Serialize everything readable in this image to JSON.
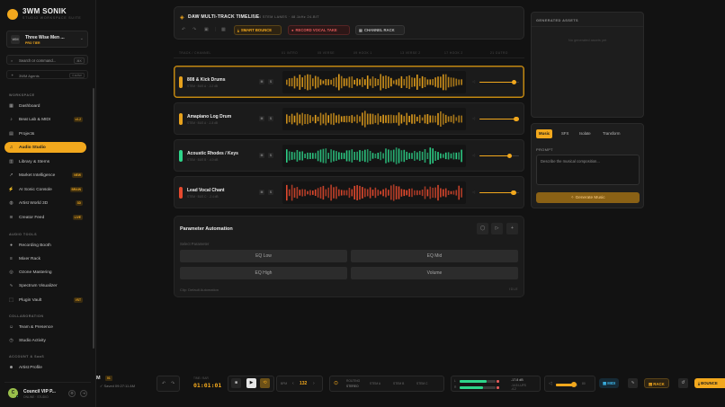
{
  "brand": {
    "title": "3WM SONIK",
    "subtitle": "STUDIO WORKSPACE SUITE"
  },
  "user": {
    "initials": "WM",
    "name": "Three Wise Men ...",
    "tier": "PRO TIER"
  },
  "search": {
    "placeholder": "Search or command...",
    "shortcut": "⌘K"
  },
  "agents": {
    "label": "3WM Agents",
    "tag": "4 active"
  },
  "sidebar": {
    "sections": [
      {
        "label": "WORKSPACE",
        "items": [
          {
            "label": "Dashboard",
            "icon": "▦",
            "badge": ""
          },
          {
            "label": "Beat Lab & MIDI",
            "icon": "♪",
            "badge": "v1.2"
          },
          {
            "label": "Projects",
            "icon": "▤",
            "badge": ""
          },
          {
            "label": "Audio Studio",
            "icon": "♫",
            "badge": "",
            "active": true
          },
          {
            "label": "Library & Stems",
            "icon": "▥",
            "badge": ""
          },
          {
            "label": "Market Intelligence",
            "icon": "↗",
            "badge": "NEW"
          },
          {
            "label": "AI Sonic Console",
            "icon": "⚡",
            "badge": "BRAIN"
          },
          {
            "label": "Artist World 3D",
            "icon": "◍",
            "badge": "3D"
          },
          {
            "label": "Creator Feed",
            "icon": "≋",
            "badge": "LIVE"
          }
        ]
      },
      {
        "label": "AUDIO TOOLS",
        "items": [
          {
            "label": "Recording Booth",
            "icon": "●",
            "badge": ""
          },
          {
            "label": "Mixer Rack",
            "icon": "≡",
            "badge": ""
          },
          {
            "label": "Ozone Mastering",
            "icon": "◎",
            "badge": ""
          },
          {
            "label": "Spectrum Visualizer",
            "icon": "∿",
            "badge": ""
          },
          {
            "label": "Plugin Vault",
            "icon": "⬚",
            "badge": "VST"
          }
        ]
      },
      {
        "label": "COLLABORATION",
        "items": [
          {
            "label": "Team & Presence",
            "icon": "☺",
            "badge": ""
          },
          {
            "label": "Studio Activity",
            "icon": "◷",
            "badge": ""
          }
        ]
      },
      {
        "label": "ACCOUNT & SaaS",
        "items": [
          {
            "label": "Artist Profile",
            "icon": "☻",
            "badge": ""
          }
        ]
      }
    ]
  },
  "council": {
    "initial": "C",
    "name": "Council VIP P...",
    "status": "ONLINE · STUDIO"
  },
  "timeline": {
    "title": "DAW MULTI-TRACK TIMELINE",
    "meta": "4 STEM LANES · 48.1kHz 24-BIT",
    "buttons": {
      "bounce": "SMART BOUNCE",
      "record": "RECORD VOCAL TAKE",
      "rack": "CHANNEL RACK"
    },
    "columns": [
      "TRACK / CHANNEL",
      "01 INTRO",
      "05 VERSE",
      "09 HOOK 1",
      "13 VERSE 2",
      "17 HOOK 2",
      "21 OUTRO"
    ]
  },
  "tracks": [
    {
      "name": "808 & Kick Drums",
      "sub": "STEM · BUS A · -3.2 dB",
      "color": "#e8a21c",
      "volume": 0.88,
      "selected": true,
      "seed": 3
    },
    {
      "name": "Amapiano Log Drum",
      "sub": "STEM · BUS A · -1.8 dB",
      "color": "#e8a21c",
      "volume": 0.93,
      "selected": false,
      "seed": 7
    },
    {
      "name": "Acoustic Rhodes / Keys",
      "sub": "STEM · BUS B · -4.0 dB",
      "color": "#2ed58a",
      "volume": 0.76,
      "selected": false,
      "seed": 11
    },
    {
      "name": "Lead Vocal Chant",
      "sub": "STEM · BUS C · -2.4 dB",
      "color": "#e64a2e",
      "volume": 0.86,
      "selected": false,
      "seed": 17
    }
  ],
  "automation": {
    "title": "Parameter Automation",
    "select_label": "Select Parameter",
    "options": [
      "EQ Low",
      "EQ Mid",
      "EQ High",
      "Volume"
    ],
    "footer": "Clip: Default Automation",
    "state": "IDLE"
  },
  "assets": {
    "title": "GENERATED ASSETS",
    "empty": "No generated assets yet"
  },
  "generator": {
    "tabs": [
      "Music",
      "SFX",
      "Isolate",
      "Transform"
    ],
    "active_tab": 0,
    "prompt_label": "PROMPT",
    "prompt_placeholder": "Describe the musical composition...",
    "button": "Generate Music"
  },
  "transport": {
    "mode": "M",
    "mode_badge": "01",
    "saved": "Saved 09:27:11 AM",
    "time_label": "TIME / BAR",
    "time": "01:01:01",
    "bpm_label": "BPM",
    "bpm": "132",
    "routing_label": "ROUTING",
    "routing_value": "STEREO",
    "lanes": [
      "STEM A",
      "STEM B",
      "STEM C"
    ],
    "meter_l": "-17.8 dB",
    "meter_r": "-14.5 LUFS",
    "meter_peak": "-4.2",
    "volume_value": "80",
    "midi": "MIDI",
    "rack": "RACK",
    "bounce": "BOUNCE"
  },
  "colors": {
    "accent": "#f2a81d",
    "record": "#e05a5a",
    "green": "#2ed58a"
  }
}
